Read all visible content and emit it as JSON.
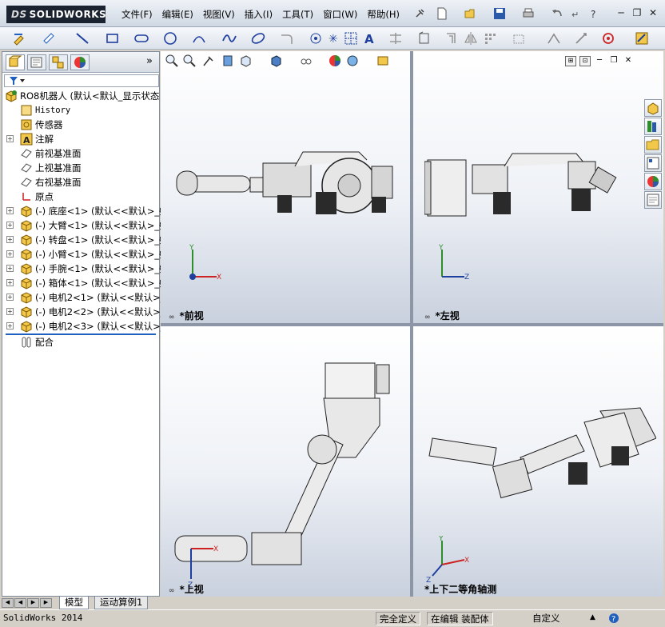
{
  "app": {
    "logo_ds": "DS",
    "logo_text": "SOLIDWORKS"
  },
  "menu": [
    "文件(F)",
    "编辑(E)",
    "视图(V)",
    "插入(I)",
    "工具(T)",
    "窗口(W)",
    "帮助(H)"
  ],
  "tree": {
    "root": "RO8机器人  (默认<默认_显示状态",
    "items": [
      {
        "label": "History",
        "icon": "history-icon",
        "exp": false
      },
      {
        "label": "传感器",
        "icon": "sensor-icon",
        "exp": false
      },
      {
        "label": "注解",
        "icon": "annotation-icon",
        "exp": true
      },
      {
        "label": "前视基准面",
        "icon": "plane-icon",
        "exp": false
      },
      {
        "label": "上视基准面",
        "icon": "plane-icon",
        "exp": false
      },
      {
        "label": "右视基准面",
        "icon": "plane-icon",
        "exp": false
      },
      {
        "label": "原点",
        "icon": "origin-icon",
        "exp": false
      },
      {
        "label": "(-) 底座<1> (默认<<默认>_§",
        "icon": "part-icon",
        "exp": true
      },
      {
        "label": "(-) 大臂<1> (默认<<默认>_§",
        "icon": "part-icon",
        "exp": true
      },
      {
        "label": "(-) 转盘<1> (默认<<默认>_§",
        "icon": "part-icon",
        "exp": true
      },
      {
        "label": "(-) 小臂<1> (默认<<默认>_§",
        "icon": "part-icon",
        "exp": true
      },
      {
        "label": "(-) 手腕<1> (默认<<默认>_§",
        "icon": "part-icon",
        "exp": true
      },
      {
        "label": "(-) 箱体<1> (默认<<默认>_§",
        "icon": "part-icon",
        "exp": true
      },
      {
        "label": "(-) 电机2<1> (默认<<默认>_",
        "icon": "part-icon",
        "exp": true
      },
      {
        "label": "(-) 电机2<2> (默认<<默认>_",
        "icon": "part-icon",
        "exp": true
      },
      {
        "label": "(-) 电机2<3> (默认<<默认>_",
        "icon": "part-icon",
        "exp": true
      },
      {
        "label": "配合",
        "icon": "mates-icon",
        "exp": false
      }
    ]
  },
  "views": {
    "front": "*前视",
    "left": "*左视",
    "top": "*上视",
    "iso": "*上下二等角轴测"
  },
  "axes": {
    "x": "X",
    "y": "Y",
    "z": "Z"
  },
  "tabs": {
    "model": "模型",
    "motion": "运动算例1"
  },
  "status": {
    "app": "SolidWorks 2014",
    "defined": "完全定义",
    "editing": "在编辑 装配体",
    "custom": "自定义"
  },
  "colors": {
    "accent": "#1f5fbf",
    "robot_body": "#e6e6e6",
    "motor": "#2a2a2a"
  }
}
